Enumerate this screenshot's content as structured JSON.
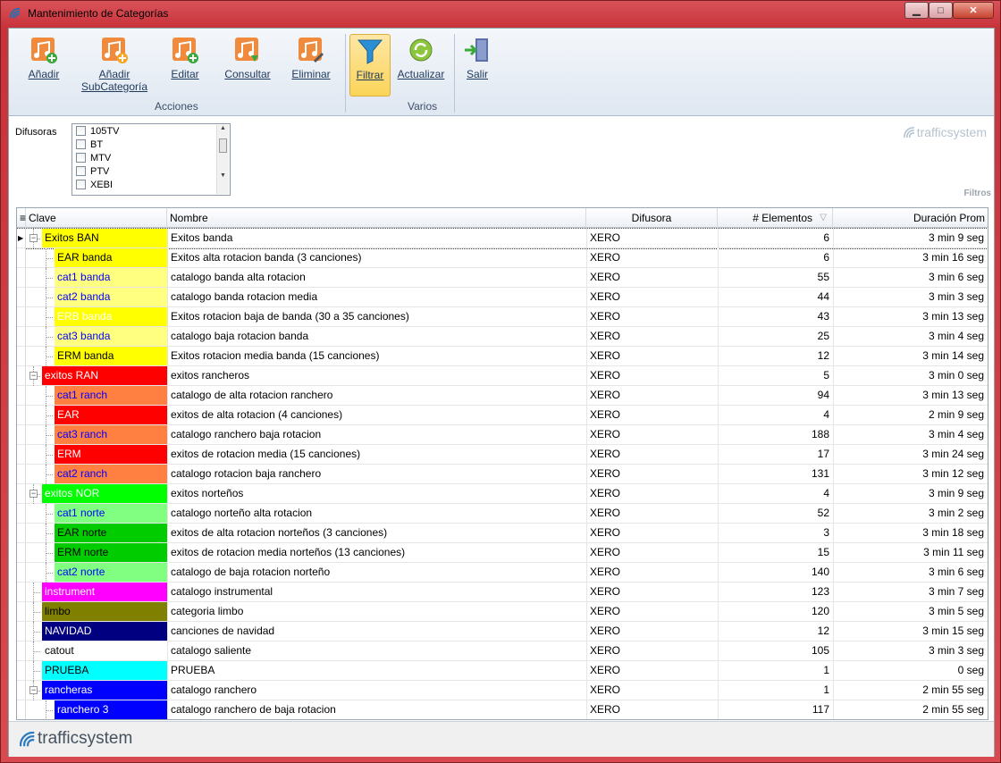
{
  "window": {
    "title": "Mantenimiento de Categorías"
  },
  "ribbon": {
    "groups": [
      {
        "label": "Acciones"
      },
      {
        "label": "Varios"
      }
    ],
    "buttons": {
      "anadir": "Añadir",
      "anadir_sub_1": "Añadir",
      "anadir_sub_2": "SubCategoría",
      "editar": "Editar",
      "consultar": "Consultar",
      "eliminar": "Eliminar",
      "filtrar": "Filtrar",
      "actualizar": "Actualizar",
      "salir": "Salir"
    }
  },
  "filter": {
    "difusoras_label": "Difusoras",
    "difusoras": [
      "105TV",
      "BT",
      "MTV",
      "PTV",
      "XEBI"
    ],
    "section_label": "Filtros"
  },
  "brand": "trafficsystem",
  "grid": {
    "columns": [
      "Clave",
      "Nombre",
      "Difusora",
      "# Elementos",
      "Duración Prom"
    ],
    "rows": [
      {
        "clave": "Exitos BAN",
        "nombre": "Exitos banda",
        "difusora": "XERO",
        "elementos": "6",
        "duracion": "3 min 9 seg",
        "level": 0,
        "expander": true,
        "bg": "#ffff00",
        "fg": "#000000"
      },
      {
        "clave": "EAR banda",
        "nombre": "Exitos alta rotacion banda (3 canciones)",
        "difusora": "XERO",
        "elementos": "6",
        "duracion": "3 min 16 seg",
        "level": 1,
        "bg": "#ffff00",
        "fg": "#000000"
      },
      {
        "clave": "cat1 banda",
        "nombre": "catalogo banda alta rotacion",
        "difusora": "XERO",
        "elementos": "55",
        "duracion": "3 min 6 seg",
        "level": 1,
        "bg": "#ffff80",
        "fg": "#0000ff"
      },
      {
        "clave": "cat2 banda",
        "nombre": "catalogo banda rotacion media",
        "difusora": "XERO",
        "elementos": "44",
        "duracion": "3 min 3 seg",
        "level": 1,
        "bg": "#ffff80",
        "fg": "#0000ff"
      },
      {
        "clave": "ERB banda",
        "nombre": "Exitos rotacion baja de banda (30 a 35 canciones)",
        "difusora": "XERO",
        "elementos": "43",
        "duracion": "3 min 13 seg",
        "level": 1,
        "bg": "#ffff00",
        "fg": "#ffffff"
      },
      {
        "clave": "cat3 banda",
        "nombre": "catalogo baja rotacion banda",
        "difusora": "XERO",
        "elementos": "25",
        "duracion": "3 min 4 seg",
        "level": 1,
        "bg": "#ffff80",
        "fg": "#0000ff"
      },
      {
        "clave": "ERM banda",
        "nombre": "Exitos rotacion media banda (15 canciones)",
        "difusora": "XERO",
        "elementos": "12",
        "duracion": "3 min 14 seg",
        "level": 1,
        "bg": "#ffff00",
        "fg": "#000000"
      },
      {
        "clave": "exitos RAN",
        "nombre": "exitos rancheros",
        "difusora": "XERO",
        "elementos": "5",
        "duracion": "3 min 0 seg",
        "level": 0,
        "expander": true,
        "bg": "#ff0000",
        "fg": "#ffffff"
      },
      {
        "clave": "cat1 ranch",
        "nombre": "catalogo de alta rotacion ranchero",
        "difusora": "XERO",
        "elementos": "94",
        "duracion": "3 min 13 seg",
        "level": 1,
        "bg": "#ff8040",
        "fg": "#0000ff"
      },
      {
        "clave": "EAR",
        "nombre": "exitos de alta rotacion (4 canciones)",
        "difusora": "XERO",
        "elementos": "4",
        "duracion": "2 min 9 seg",
        "level": 1,
        "bg": "#ff0000",
        "fg": "#ffffff"
      },
      {
        "clave": "cat3 ranch",
        "nombre": "catalogo ranchero baja rotacion",
        "difusora": "XERO",
        "elementos": "188",
        "duracion": "3 min 4 seg",
        "level": 1,
        "bg": "#ff8040",
        "fg": "#0000ff"
      },
      {
        "clave": "ERM",
        "nombre": "exitos de rotacion media (15 canciones)",
        "difusora": "XERO",
        "elementos": "17",
        "duracion": "3 min 24 seg",
        "level": 1,
        "bg": "#ff0000",
        "fg": "#ffffff"
      },
      {
        "clave": "cat2 ranch",
        "nombre": "catalogo rotacion baja ranchero",
        "difusora": "XERO",
        "elementos": "131",
        "duracion": "3 min 12 seg",
        "level": 1,
        "bg": "#ff8040",
        "fg": "#0000ff"
      },
      {
        "clave": "exitos NOR",
        "nombre": "exitos norteños",
        "difusora": "XERO",
        "elementos": "4",
        "duracion": "3 min 9 seg",
        "level": 0,
        "expander": true,
        "bg": "#00ff00",
        "fg": "#ffffff"
      },
      {
        "clave": "cat1 norte",
        "nombre": "catalogo norteño alta rotacion",
        "difusora": "XERO",
        "elementos": "52",
        "duracion": "3 min 2 seg",
        "level": 1,
        "bg": "#80ff80",
        "fg": "#0000ff"
      },
      {
        "clave": "EAR norte",
        "nombre": "exitos de alta rotacion norteños (3 canciones)",
        "difusora": "XERO",
        "elementos": "3",
        "duracion": "3 min 18 seg",
        "level": 1,
        "bg": "#00cc00",
        "fg": "#000000"
      },
      {
        "clave": "ERM norte",
        "nombre": "exitos de rotacion media norteños (13 canciones)",
        "difusora": "XERO",
        "elementos": "15",
        "duracion": "3 min 11 seg",
        "level": 1,
        "bg": "#00cc00",
        "fg": "#000000"
      },
      {
        "clave": "cat2 norte",
        "nombre": "catalogo de baja rotacion norteño",
        "difusora": "XERO",
        "elementos": "140",
        "duracion": "3 min 6 seg",
        "level": 1,
        "bg": "#80ff80",
        "fg": "#0000ff"
      },
      {
        "clave": "instrument",
        "nombre": "catalogo instrumental",
        "difusora": "XERO",
        "elementos": "123",
        "duracion": "3 min 7 seg",
        "level": 0,
        "bg": "#ff00ff",
        "fg": "#ffffff"
      },
      {
        "clave": "limbo",
        "nombre": "categoria limbo",
        "difusora": "XERO",
        "elementos": "120",
        "duracion": "3 min 5 seg",
        "level": 0,
        "bg": "#808000",
        "fg": "#000000"
      },
      {
        "clave": "NAVIDAD",
        "nombre": "canciones de navidad",
        "difusora": "XERO",
        "elementos": "12",
        "duracion": "3 min 15 seg",
        "level": 0,
        "bg": "#000080",
        "fg": "#ffffff"
      },
      {
        "clave": "catout",
        "nombre": "catalogo saliente",
        "difusora": "XERO",
        "elementos": "105",
        "duracion": "3 min 3 seg",
        "level": 0,
        "bg": "#ffffff",
        "fg": "#000000"
      },
      {
        "clave": "PRUEBA",
        "nombre": "PRUEBA",
        "difusora": "XERO",
        "elementos": "1",
        "duracion": "0 seg",
        "level": 0,
        "bg": "#00ffff",
        "fg": "#000000"
      },
      {
        "clave": "rancheras",
        "nombre": "catalogo ranchero",
        "difusora": "XERO",
        "elementos": "1",
        "duracion": "2 min 55 seg",
        "level": 0,
        "expander": true,
        "bg": "#0000ff",
        "fg": "#ffffff"
      },
      {
        "clave": "ranchero 3",
        "nombre": "catalogo ranchero de baja rotacion",
        "difusora": "XERO",
        "elementos": "117",
        "duracion": "2 min 55 seg",
        "level": 1,
        "bg": "#0000ff",
        "fg": "#ffffff"
      }
    ]
  }
}
